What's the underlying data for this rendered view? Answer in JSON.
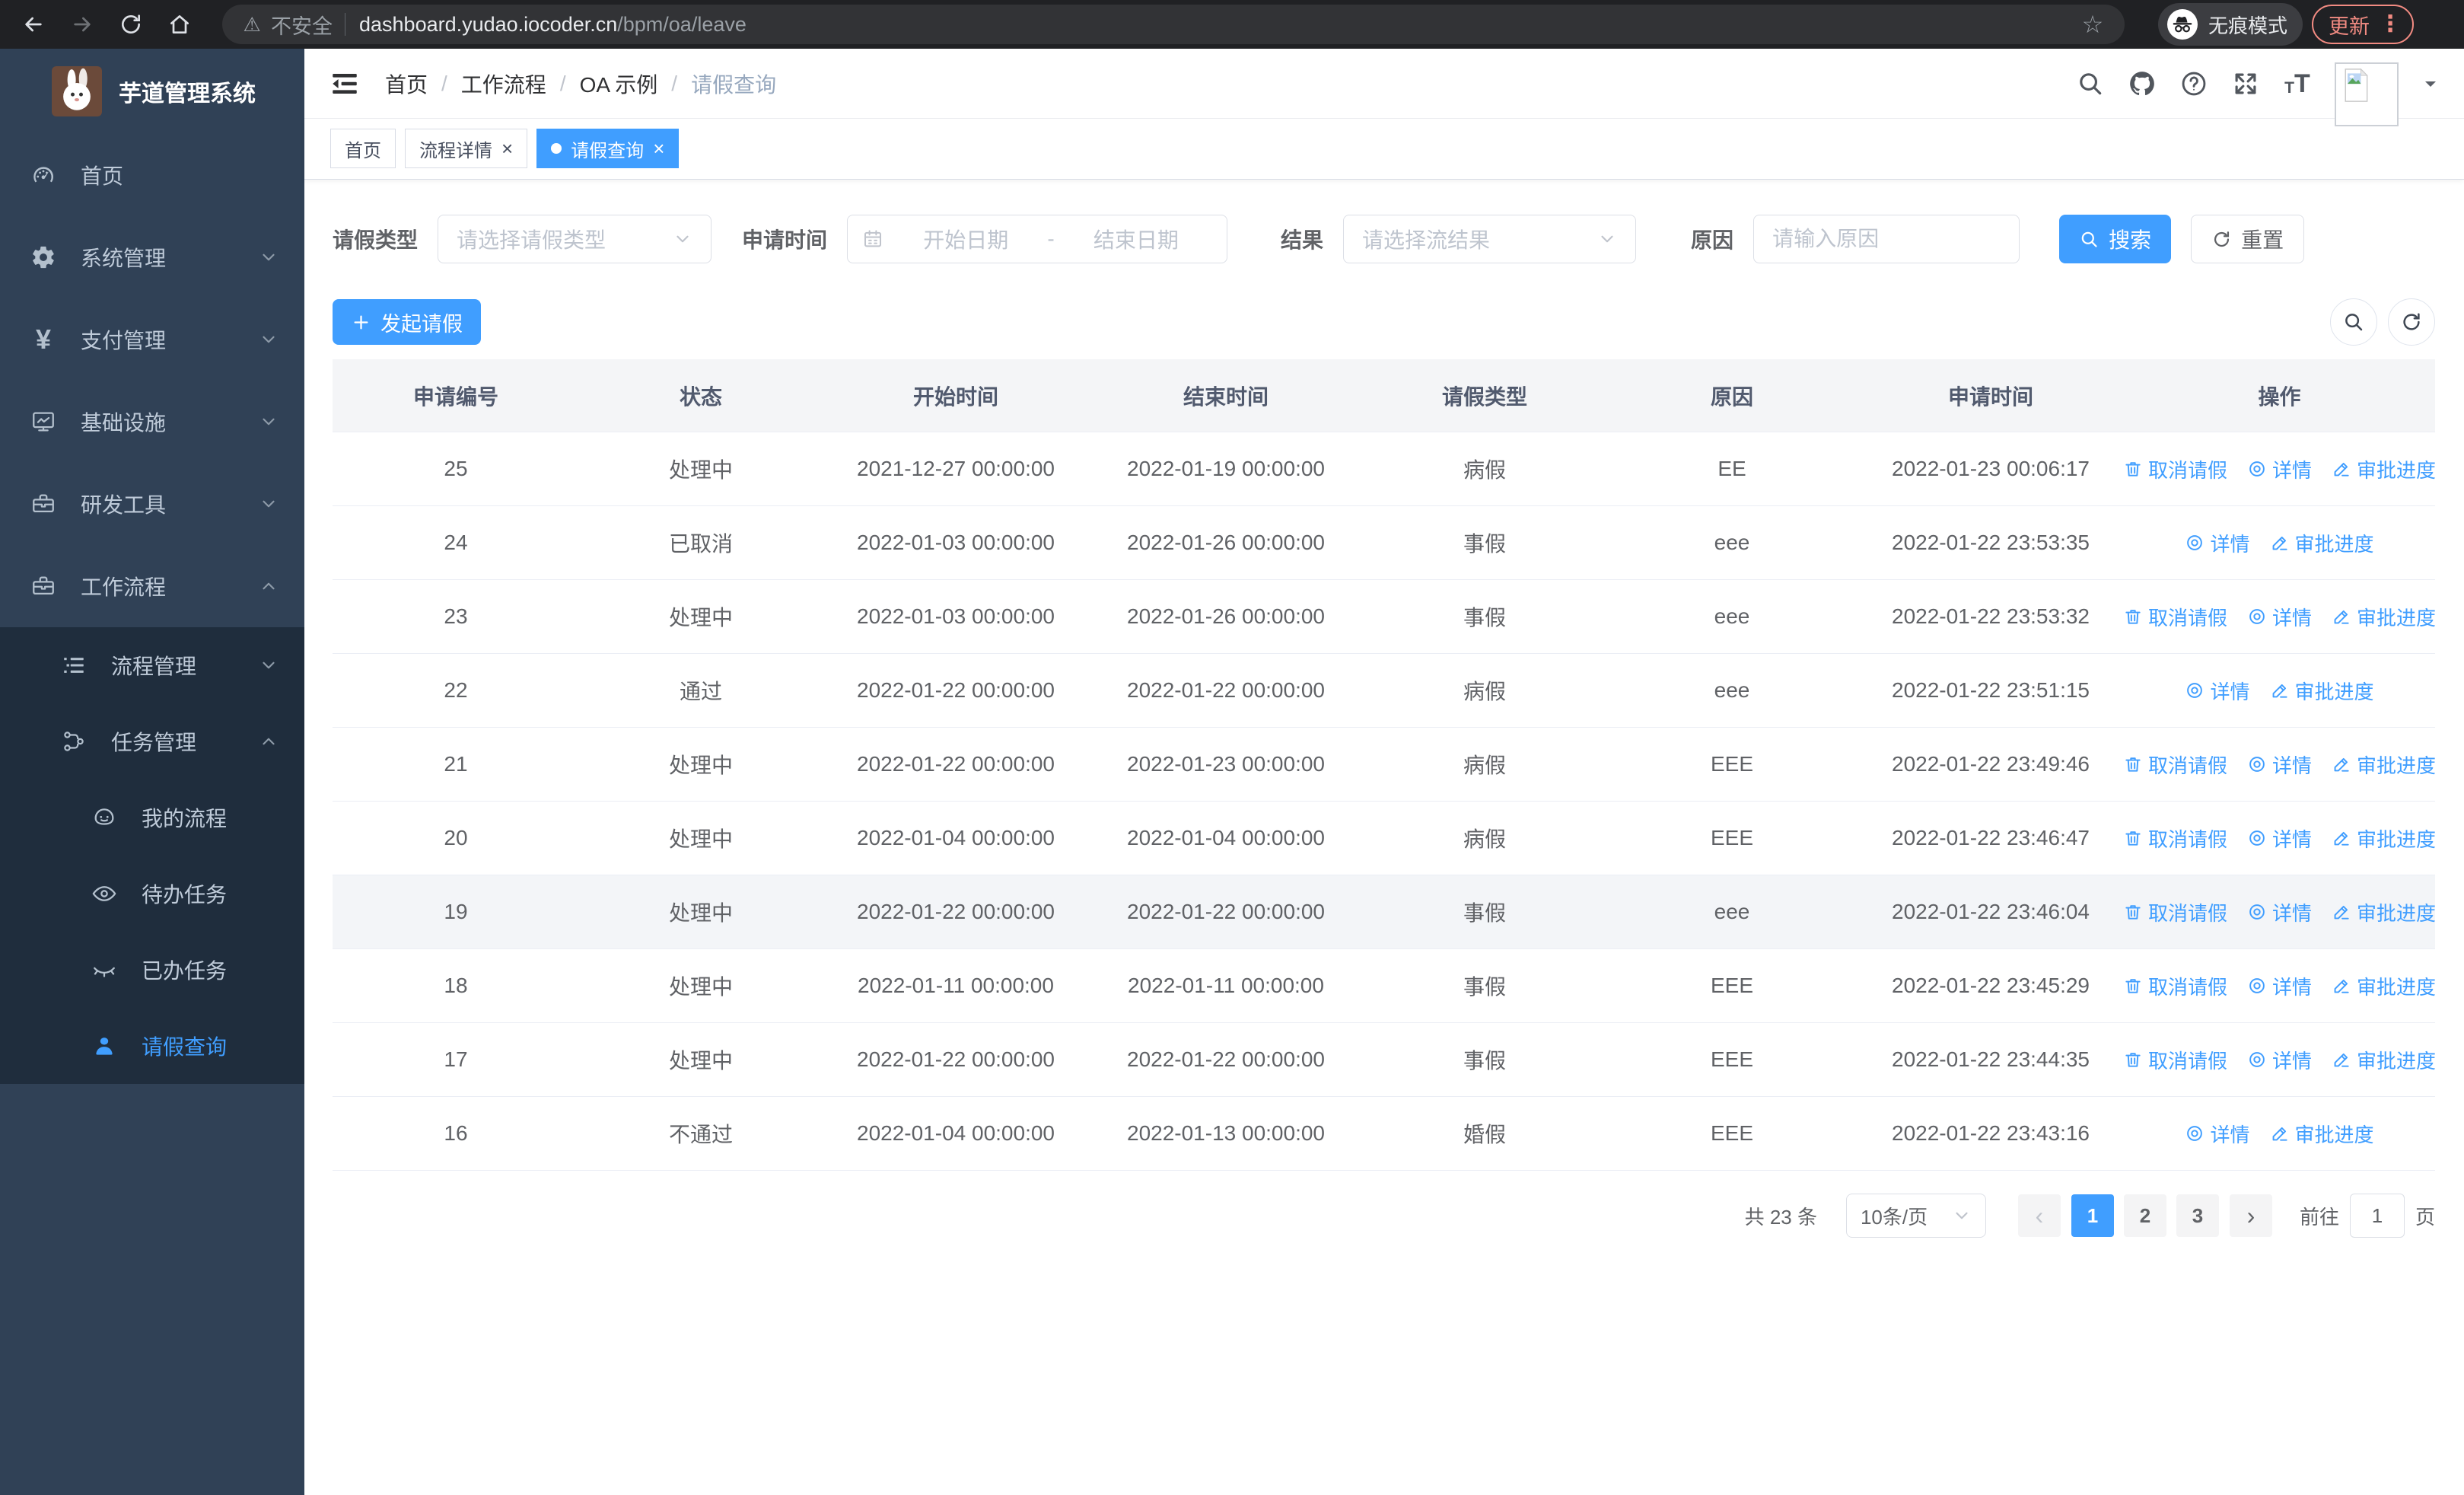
{
  "browser": {
    "security_label": "不安全",
    "url_host": "dashboard.yudao.iocoder.cn",
    "url_path": "/bpm/oa/leave",
    "incognito_label": "无痕模式",
    "update_label": "更新"
  },
  "sidebar": {
    "title": "芋道管理系统",
    "menu": [
      {
        "label": "首页",
        "icon": "gauge-icon",
        "level": 1
      },
      {
        "label": "系统管理",
        "icon": "gear-icon",
        "level": 1,
        "arrow": "down"
      },
      {
        "label": "支付管理",
        "icon": "yen-icon",
        "level": 1,
        "arrow": "down"
      },
      {
        "label": "基础设施",
        "icon": "monitor-icon",
        "level": 1,
        "arrow": "down"
      },
      {
        "label": "研发工具",
        "icon": "toolbox-icon",
        "level": 1,
        "arrow": "down"
      },
      {
        "label": "工作流程",
        "icon": "briefcase-icon",
        "level": 1,
        "arrow": "up"
      },
      {
        "label": "流程管理",
        "icon": "list-tree-icon",
        "level": 2,
        "arrow": "down"
      },
      {
        "label": "任务管理",
        "icon": "flow-icon",
        "level": 2,
        "arrow": "up"
      },
      {
        "label": "我的流程",
        "icon": "face-icon",
        "level": 3
      },
      {
        "label": "待办任务",
        "icon": "eye-open-icon",
        "level": 3
      },
      {
        "label": "已办任务",
        "icon": "eye-closed-icon",
        "level": 3
      },
      {
        "label": "请假查询",
        "icon": "user-icon",
        "level": 3,
        "active": true
      }
    ]
  },
  "navbar": {
    "breadcrumb": [
      "首页",
      "工作流程",
      "OA 示例",
      "请假查询"
    ],
    "breadcrumb_separator": "/",
    "right_icons": [
      "search-icon",
      "github-icon",
      "help-icon",
      "fullscreen-icon",
      "font-size-icon"
    ]
  },
  "tabs": [
    {
      "label": "首页",
      "closable": false,
      "active": false
    },
    {
      "label": "流程详情",
      "closable": true,
      "active": false
    },
    {
      "label": "请假查询",
      "closable": true,
      "active": true
    }
  ],
  "filters": {
    "type_label": "请假类型",
    "type_placeholder": "请选择请假类型",
    "time_label": "申请时间",
    "start_placeholder": "开始日期",
    "range_separator": "-",
    "end_placeholder": "结束日期",
    "result_label": "结果",
    "result_placeholder": "请选择流结果",
    "reason_label": "原因",
    "reason_placeholder": "请输入原因",
    "search_label": "搜索",
    "reset_label": "重置"
  },
  "toolbar": {
    "create_label": "发起请假"
  },
  "table": {
    "columns": [
      "申请编号",
      "状态",
      "开始时间",
      "结束时间",
      "请假类型",
      "原因",
      "申请时间",
      "操作"
    ],
    "action_labels": {
      "cancel": "取消请假",
      "detail": "详情",
      "progress": "审批进度"
    },
    "rows": [
      {
        "id": "25",
        "status": "处理中",
        "start": "2021-12-27 00:00:00",
        "end": "2022-01-19 00:00:00",
        "type": "病假",
        "reason": "EE",
        "applied": "2022-01-23 00:06:17",
        "actions": [
          "cancel",
          "detail",
          "progress"
        ]
      },
      {
        "id": "24",
        "status": "已取消",
        "start": "2022-01-03 00:00:00",
        "end": "2022-01-26 00:00:00",
        "type": "事假",
        "reason": "eee",
        "applied": "2022-01-22 23:53:35",
        "actions": [
          "detail",
          "progress"
        ]
      },
      {
        "id": "23",
        "status": "处理中",
        "start": "2022-01-03 00:00:00",
        "end": "2022-01-26 00:00:00",
        "type": "事假",
        "reason": "eee",
        "applied": "2022-01-22 23:53:32",
        "actions": [
          "cancel",
          "detail",
          "progress"
        ]
      },
      {
        "id": "22",
        "status": "通过",
        "start": "2022-01-22 00:00:00",
        "end": "2022-01-22 00:00:00",
        "type": "病假",
        "reason": "eee",
        "applied": "2022-01-22 23:51:15",
        "actions": [
          "detail",
          "progress"
        ]
      },
      {
        "id": "21",
        "status": "处理中",
        "start": "2022-01-22 00:00:00",
        "end": "2022-01-23 00:00:00",
        "type": "病假",
        "reason": "EEE",
        "applied": "2022-01-22 23:49:46",
        "actions": [
          "cancel",
          "detail",
          "progress"
        ]
      },
      {
        "id": "20",
        "status": "处理中",
        "start": "2022-01-04 00:00:00",
        "end": "2022-01-04 00:00:00",
        "type": "病假",
        "reason": "EEE",
        "applied": "2022-01-22 23:46:47",
        "actions": [
          "cancel",
          "detail",
          "progress"
        ]
      },
      {
        "id": "19",
        "status": "处理中",
        "start": "2022-01-22 00:00:00",
        "end": "2022-01-22 00:00:00",
        "type": "事假",
        "reason": "eee",
        "applied": "2022-01-22 23:46:04",
        "actions": [
          "cancel",
          "detail",
          "progress"
        ],
        "highlighted": true
      },
      {
        "id": "18",
        "status": "处理中",
        "start": "2022-01-11 00:00:00",
        "end": "2022-01-11 00:00:00",
        "type": "事假",
        "reason": "EEE",
        "applied": "2022-01-22 23:45:29",
        "actions": [
          "cancel",
          "detail",
          "progress"
        ]
      },
      {
        "id": "17",
        "status": "处理中",
        "start": "2022-01-22 00:00:00",
        "end": "2022-01-22 00:00:00",
        "type": "事假",
        "reason": "EEE",
        "applied": "2022-01-22 23:44:35",
        "actions": [
          "cancel",
          "detail",
          "progress"
        ]
      },
      {
        "id": "16",
        "status": "不通过",
        "start": "2022-01-04 00:00:00",
        "end": "2022-01-13 00:00:00",
        "type": "婚假",
        "reason": "EEE",
        "applied": "2022-01-22 23:43:16",
        "actions": [
          "detail",
          "progress"
        ]
      }
    ]
  },
  "pagination": {
    "total_label": "共 23 条",
    "page_size_label": "10条/页",
    "pages": [
      "1",
      "2",
      "3"
    ],
    "active_page": "1",
    "goto_label": "前往",
    "goto_value": "1",
    "page_unit_label": "页"
  },
  "colors": {
    "accent": "#409eff",
    "sidebar_bg": "#304156",
    "submenu_bg": "#1f2d3d",
    "update_accent": "#f28b82"
  }
}
